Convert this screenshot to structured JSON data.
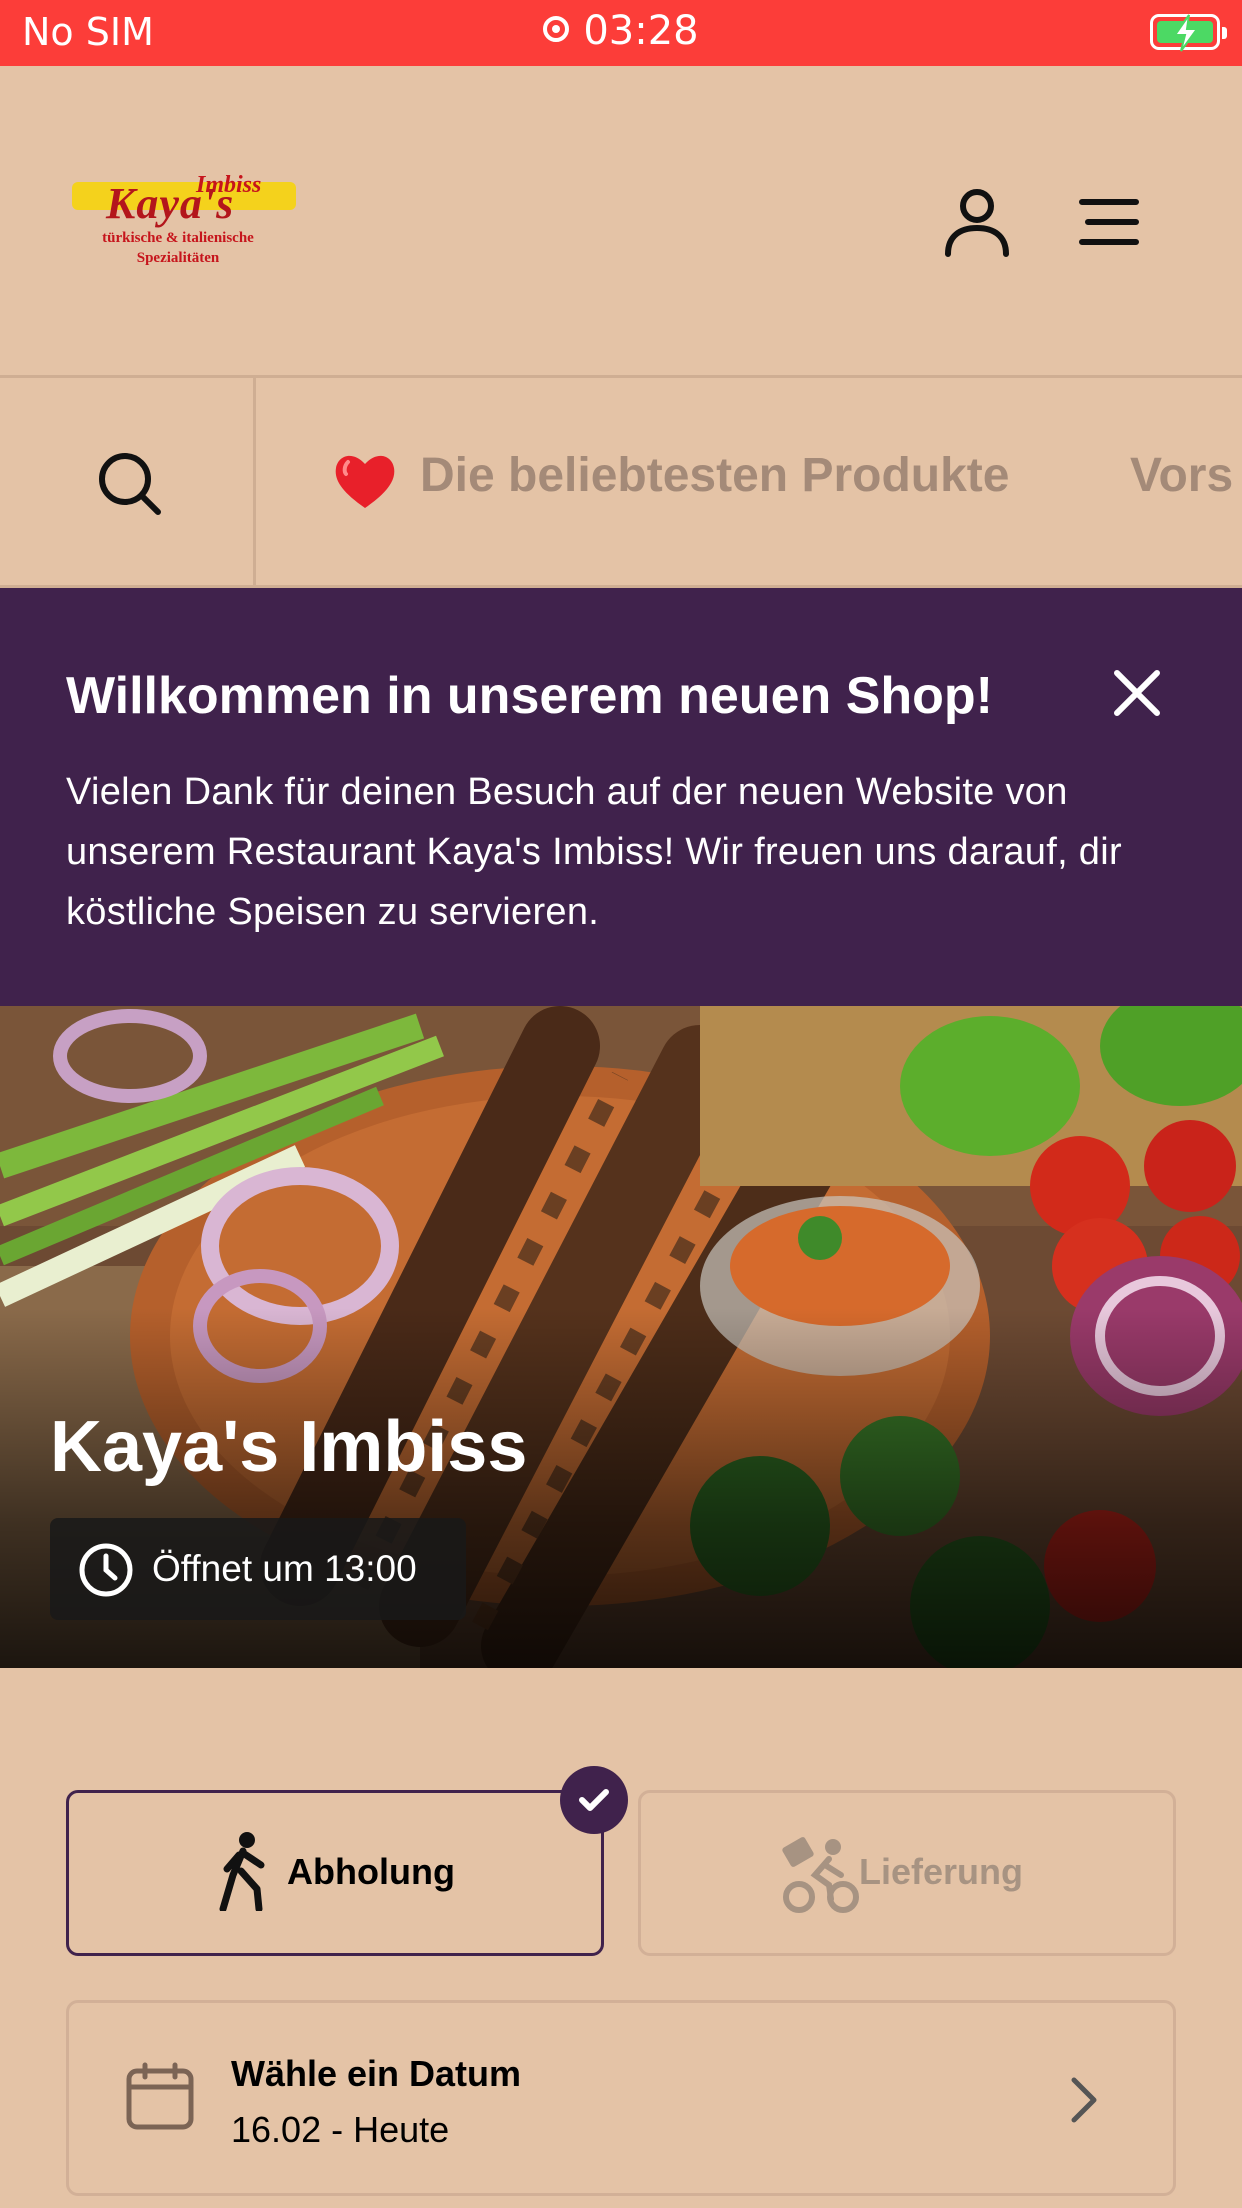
{
  "status_bar": {
    "carrier": "No SIM",
    "time": "03:28"
  },
  "header": {
    "logo": {
      "line1": "Imbiss",
      "line2": "Kaya's",
      "tagline": "türkische & italienische Spezialitäten"
    }
  },
  "tabs": {
    "items": [
      {
        "emoji": "❤️",
        "label": "Die beliebtesten Produkte"
      },
      {
        "label": "Vors"
      }
    ]
  },
  "banner": {
    "title": "Willkommen in unserem neuen Shop!",
    "text": "Vielen Dank für deinen Besuch auf der neuen Website von unserem Restaurant Kaya's Imbiss! Wir freuen uns darauf, dir köstliche Speisen zu servieren."
  },
  "hero": {
    "title": "Kaya's Imbiss",
    "hours": "Öffnet um 13:00"
  },
  "order_mode": {
    "pickup": "Abholung",
    "delivery": "Lieferung",
    "selected": "pickup"
  },
  "date_picker": {
    "title": "Wähle ein Datum",
    "value": "16.02 - Heute"
  },
  "colors": {
    "primary": "#40224c",
    "background": "#e4c3a6",
    "status_bar": "#fc3d39"
  }
}
